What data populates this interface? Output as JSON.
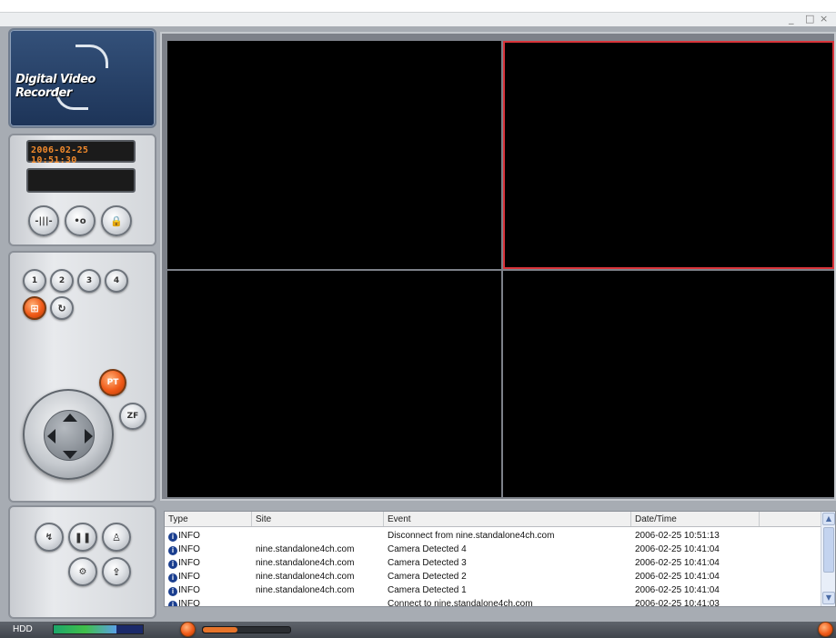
{
  "window": {
    "controls": {
      "minimize": "_",
      "maximize": "□",
      "close": "×"
    }
  },
  "logo": {
    "text": "Digital Video Recorder"
  },
  "clock": {
    "datetime": "2006-02-25 10:51:30"
  },
  "status_display": {
    "text": ""
  },
  "control_buttons": [
    {
      "icon": "audio-waveform-icon"
    },
    {
      "icon": "record-icon"
    },
    {
      "icon": "lock-icon"
    }
  ],
  "camera_buttons": [
    {
      "label": "1"
    },
    {
      "label": "2"
    },
    {
      "label": "3"
    },
    {
      "label": "4"
    }
  ],
  "view_buttons": [
    {
      "icon": "quad-view-icon",
      "active": true
    },
    {
      "icon": "sequence-icon",
      "active": false
    }
  ],
  "ptz": {
    "pt_label": "PT",
    "zf_label": "ZF"
  },
  "bottom_buttons": [
    {
      "icon": "search-icon"
    },
    {
      "icon": "pause-icon"
    },
    {
      "icon": "user-icon"
    },
    {
      "icon": "settings-icon"
    },
    {
      "icon": "backup-icon"
    }
  ],
  "events": {
    "columns": [
      "Type",
      "Site",
      "Event",
      "Date/Time",
      ""
    ],
    "rows": [
      {
        "type": "INFO",
        "site": "",
        "event": "Disconnect from nine.standalone4ch.com",
        "datetime": "2006-02-25 10:51:13"
      },
      {
        "type": "INFO",
        "site": "nine.standalone4ch.com",
        "event": "Camera Detected 4",
        "datetime": "2006-02-25 10:41:04"
      },
      {
        "type": "INFO",
        "site": "nine.standalone4ch.com",
        "event": "Camera Detected 3",
        "datetime": "2006-02-25 10:41:04"
      },
      {
        "type": "INFO",
        "site": "nine.standalone4ch.com",
        "event": "Camera Detected 2",
        "datetime": "2006-02-25 10:41:04"
      },
      {
        "type": "INFO",
        "site": "nine.standalone4ch.com",
        "event": "Camera Detected 1",
        "datetime": "2006-02-25 10:41:04"
      },
      {
        "type": "INFO",
        "site": "",
        "event": "Connect to nine.standalone4ch.com",
        "datetime": "2006-02-25 10:41:03"
      }
    ]
  },
  "statusbar": {
    "hdd_label": "HDD",
    "hdd_level": 0.7,
    "volume_level": 0.4
  },
  "colors": {
    "selected_border": "#d9343a",
    "clock_text": "#f28a2c",
    "accent": "#f05a18"
  }
}
